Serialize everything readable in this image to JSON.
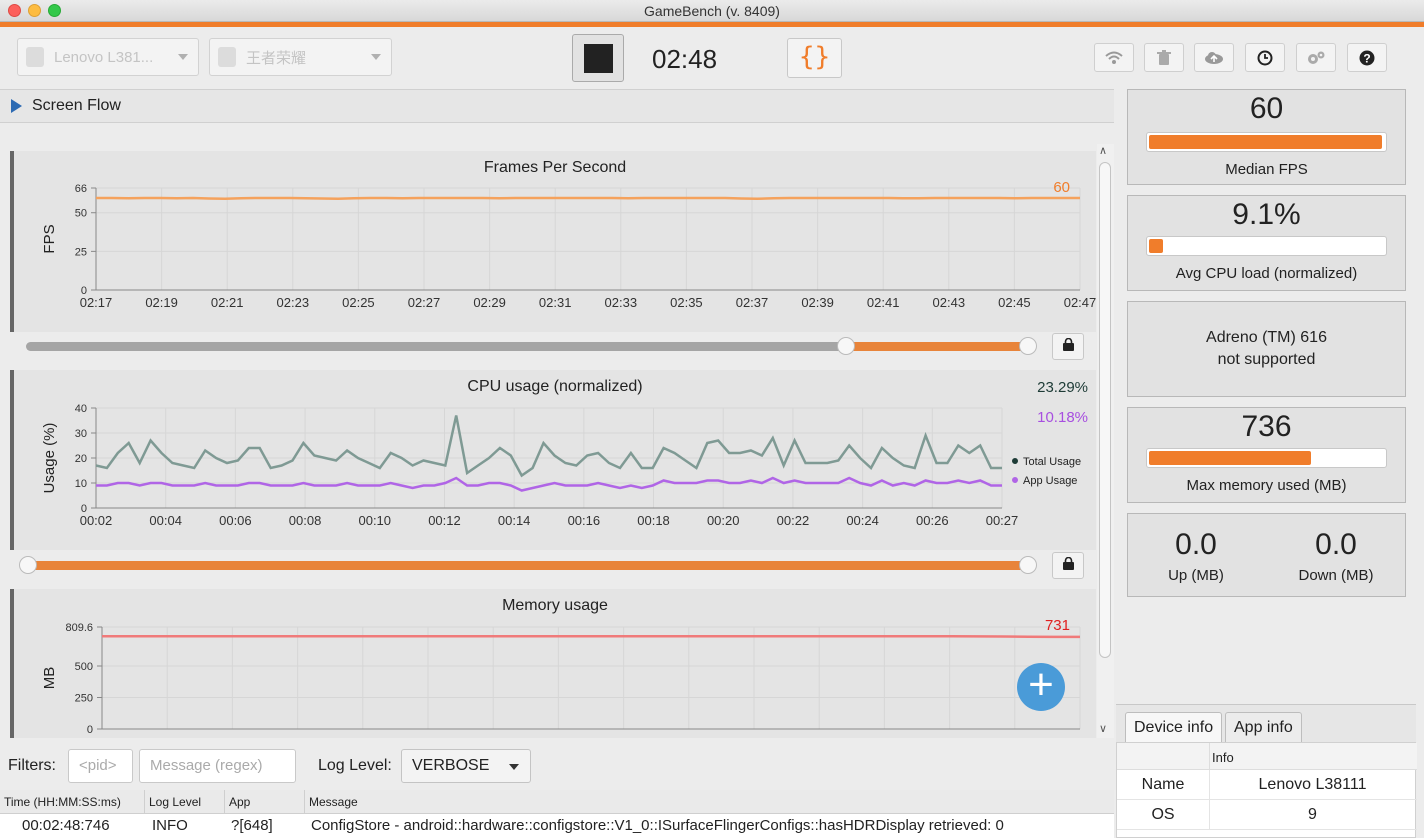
{
  "window": {
    "title": "GameBench (v. 8409)"
  },
  "toolbar": {
    "device_select": "Lenovo L381...",
    "app_select": "王者荣耀",
    "timer": "02:48",
    "brace_label": "{}",
    "icons": [
      "wifi-icon",
      "trash-icon",
      "cloud-upload-icon",
      "clock-icon",
      "settings-icon",
      "help-icon"
    ]
  },
  "screen_flow": {
    "label": "Screen Flow"
  },
  "chart_data": [
    {
      "type": "line",
      "title": "Frames Per Second",
      "ylabel": "FPS",
      "ylim": [
        0,
        66
      ],
      "y_ticks": [
        "0",
        "25",
        "50",
        "66"
      ],
      "x_ticks": [
        "02:17",
        "02:19",
        "02:21",
        "02:23",
        "02:25",
        "02:27",
        "02:29",
        "02:31",
        "02:33",
        "02:35",
        "02:37",
        "02:39",
        "02:41",
        "02:43",
        "02:45",
        "02:47"
      ],
      "series": [
        {
          "color": "#f5a25d",
          "values": [
            59.5,
            59.5,
            59.4,
            59.5,
            59.5,
            59.4,
            59.5,
            59.2,
            59.0,
            59.4,
            59.5,
            59.5,
            59.5,
            59.4,
            59.2,
            59.0,
            59.4,
            59.5,
            59.5,
            59.4,
            59.5,
            59.5,
            59.5,
            59.5,
            59.5,
            59.4,
            59.5,
            59.5,
            59.5,
            59.5,
            59.5,
            59.5,
            59.5,
            59.4,
            59.5,
            59.5,
            59.5,
            59.5,
            59.5,
            59.5,
            59.2,
            59.0,
            59.4,
            59.5,
            59.5,
            59.5,
            59.5,
            59.5,
            59.5,
            59.5,
            59.4,
            59.4,
            59.5,
            59.5,
            59.5,
            59.5,
            59.5,
            59.4,
            59.5,
            59.5,
            59.5,
            59.5
          ]
        }
      ],
      "current_value": "60"
    },
    {
      "type": "line",
      "title": "CPU usage (normalized)",
      "ylabel": "Usage (%)",
      "ylim": [
        0,
        40
      ],
      "y_ticks": [
        "0",
        "10",
        "20",
        "30",
        "40"
      ],
      "x_ticks": [
        "00:02",
        "00:04",
        "00:06",
        "00:08",
        "00:10",
        "00:12",
        "00:14",
        "00:16",
        "00:18",
        "00:20",
        "00:22",
        "00:24",
        "00:26",
        "00:27"
      ],
      "series": [
        {
          "name": "Total Usage",
          "color": "#7f9a94",
          "values": [
            17,
            16,
            22,
            26,
            18,
            27,
            22,
            18,
            17,
            16,
            23,
            20,
            18,
            19,
            24,
            24,
            16,
            17,
            19,
            26,
            21,
            20,
            19,
            23,
            20,
            18,
            16,
            22,
            20,
            17,
            19,
            18,
            17,
            37,
            14,
            17,
            20,
            24,
            21,
            13,
            16,
            26,
            21,
            18,
            17,
            21,
            22,
            18,
            16,
            22,
            16,
            16,
            24,
            22,
            19,
            16,
            26,
            27,
            22,
            22,
            23,
            21,
            28,
            17,
            27,
            18,
            18,
            18,
            19,
            25,
            20,
            16,
            24,
            20,
            17,
            16,
            29,
            18,
            18,
            25,
            22,
            25,
            16,
            16
          ]
        },
        {
          "name": "App Usage",
          "color": "#b065e6",
          "values": [
            9,
            9,
            10,
            10,
            9,
            10,
            10,
            9,
            9,
            9,
            10,
            9,
            9,
            9,
            10,
            10,
            9,
            9,
            9,
            10,
            9,
            9,
            9,
            10,
            9,
            9,
            9,
            10,
            9,
            8,
            9,
            9,
            10,
            12,
            9,
            9,
            10,
            10,
            9,
            7,
            8,
            9,
            10,
            9,
            9,
            9,
            10,
            9,
            8,
            9,
            8,
            9,
            11,
            10,
            10,
            10,
            11,
            11,
            10,
            10,
            11,
            10,
            12,
            10,
            11,
            10,
            10,
            10,
            10,
            12,
            10,
            9,
            11,
            9,
            10,
            9,
            11,
            10,
            10,
            11,
            10,
            11,
            9,
            9
          ]
        }
      ],
      "legend": [
        "Total Usage",
        "App Usage"
      ],
      "current_total": "23.29%",
      "current_app": "10.18%"
    },
    {
      "type": "line",
      "title": "Memory usage",
      "ylabel": "MB",
      "ylim": [
        0,
        809.6
      ],
      "y_ticks": [
        "0",
        "250",
        "500",
        "809.6"
      ],
      "series": [
        {
          "color": "#f07a7a",
          "values": [
            736,
            736,
            736,
            736,
            736,
            736,
            736,
            736,
            736,
            736,
            736,
            736,
            736,
            736,
            736,
            736,
            736,
            736,
            736,
            736,
            736,
            736,
            736,
            736,
            736,
            736,
            736,
            736,
            736,
            736,
            736,
            736,
            736,
            736,
            735,
            734,
            732,
            731,
            731
          ]
        }
      ],
      "current_value": "731"
    }
  ],
  "filters": {
    "label": "Filters:",
    "pid_placeholder": "<pid>",
    "message_placeholder": "Message (regex)",
    "log_level_label": "Log Level:",
    "log_level_value": "VERBOSE"
  },
  "log": {
    "columns": [
      "Time (HH:MM:SS:ms)",
      "Log Level",
      "App",
      "Message"
    ],
    "rows": [
      {
        "time": "00:02:48:746",
        "level": "INFO",
        "app": "?[648]",
        "message": "ConfigStore - android::hardware::configstore::V1_0::ISurfaceFlingerConfigs::hasHDRDisplay retrieved: 0"
      }
    ]
  },
  "stats": {
    "median_fps": {
      "value": "60",
      "label": "Median FPS",
      "fill": 0.99
    },
    "avg_cpu": {
      "value": "9.1%",
      "label": "Avg CPU load (normalized)",
      "fill": 0.06
    },
    "gpu": {
      "line1": "Adreno (TM) 616",
      "line2": "not supported"
    },
    "max_memory": {
      "value": "736",
      "label": "Max memory used (MB)",
      "fill": 0.69
    },
    "network": {
      "up_value": "0.0",
      "up_label": "Up (MB)",
      "down_value": "0.0",
      "down_label": "Down (MB)"
    }
  },
  "info_tabs": [
    "Device info",
    "App info"
  ],
  "device_info": {
    "header": "Info",
    "rows": [
      {
        "key": "Name",
        "value": "Lenovo L38111"
      },
      {
        "key": "OS",
        "value": "9"
      }
    ]
  },
  "colors": {
    "accent": "#f07d2b",
    "fab": "#4a9bd8"
  }
}
